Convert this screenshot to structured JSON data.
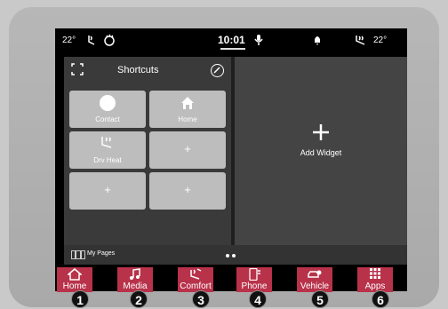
{
  "status": {
    "temp_left": "22°",
    "time": "10:01",
    "temp_right": "22°"
  },
  "shortcuts": {
    "title": "Shortcuts",
    "tiles": [
      {
        "label": "Contact"
      },
      {
        "label": "Home"
      },
      {
        "label": "Drv Heat"
      },
      {
        "label": "+"
      },
      {
        "label": "+"
      },
      {
        "label": "+"
      }
    ]
  },
  "widget": {
    "add_label": "Add Widget"
  },
  "mypages": {
    "label": "My Pages"
  },
  "nav": [
    {
      "label": "Home",
      "badge": "1"
    },
    {
      "label": "Media",
      "badge": "2"
    },
    {
      "label": "Comfort",
      "badge": "3"
    },
    {
      "label": "Phone",
      "badge": "4"
    },
    {
      "label": "Vehicle",
      "badge": "5"
    },
    {
      "label": "Apps",
      "badge": "6"
    }
  ],
  "colors": {
    "nav_accent": "#b8324a"
  }
}
